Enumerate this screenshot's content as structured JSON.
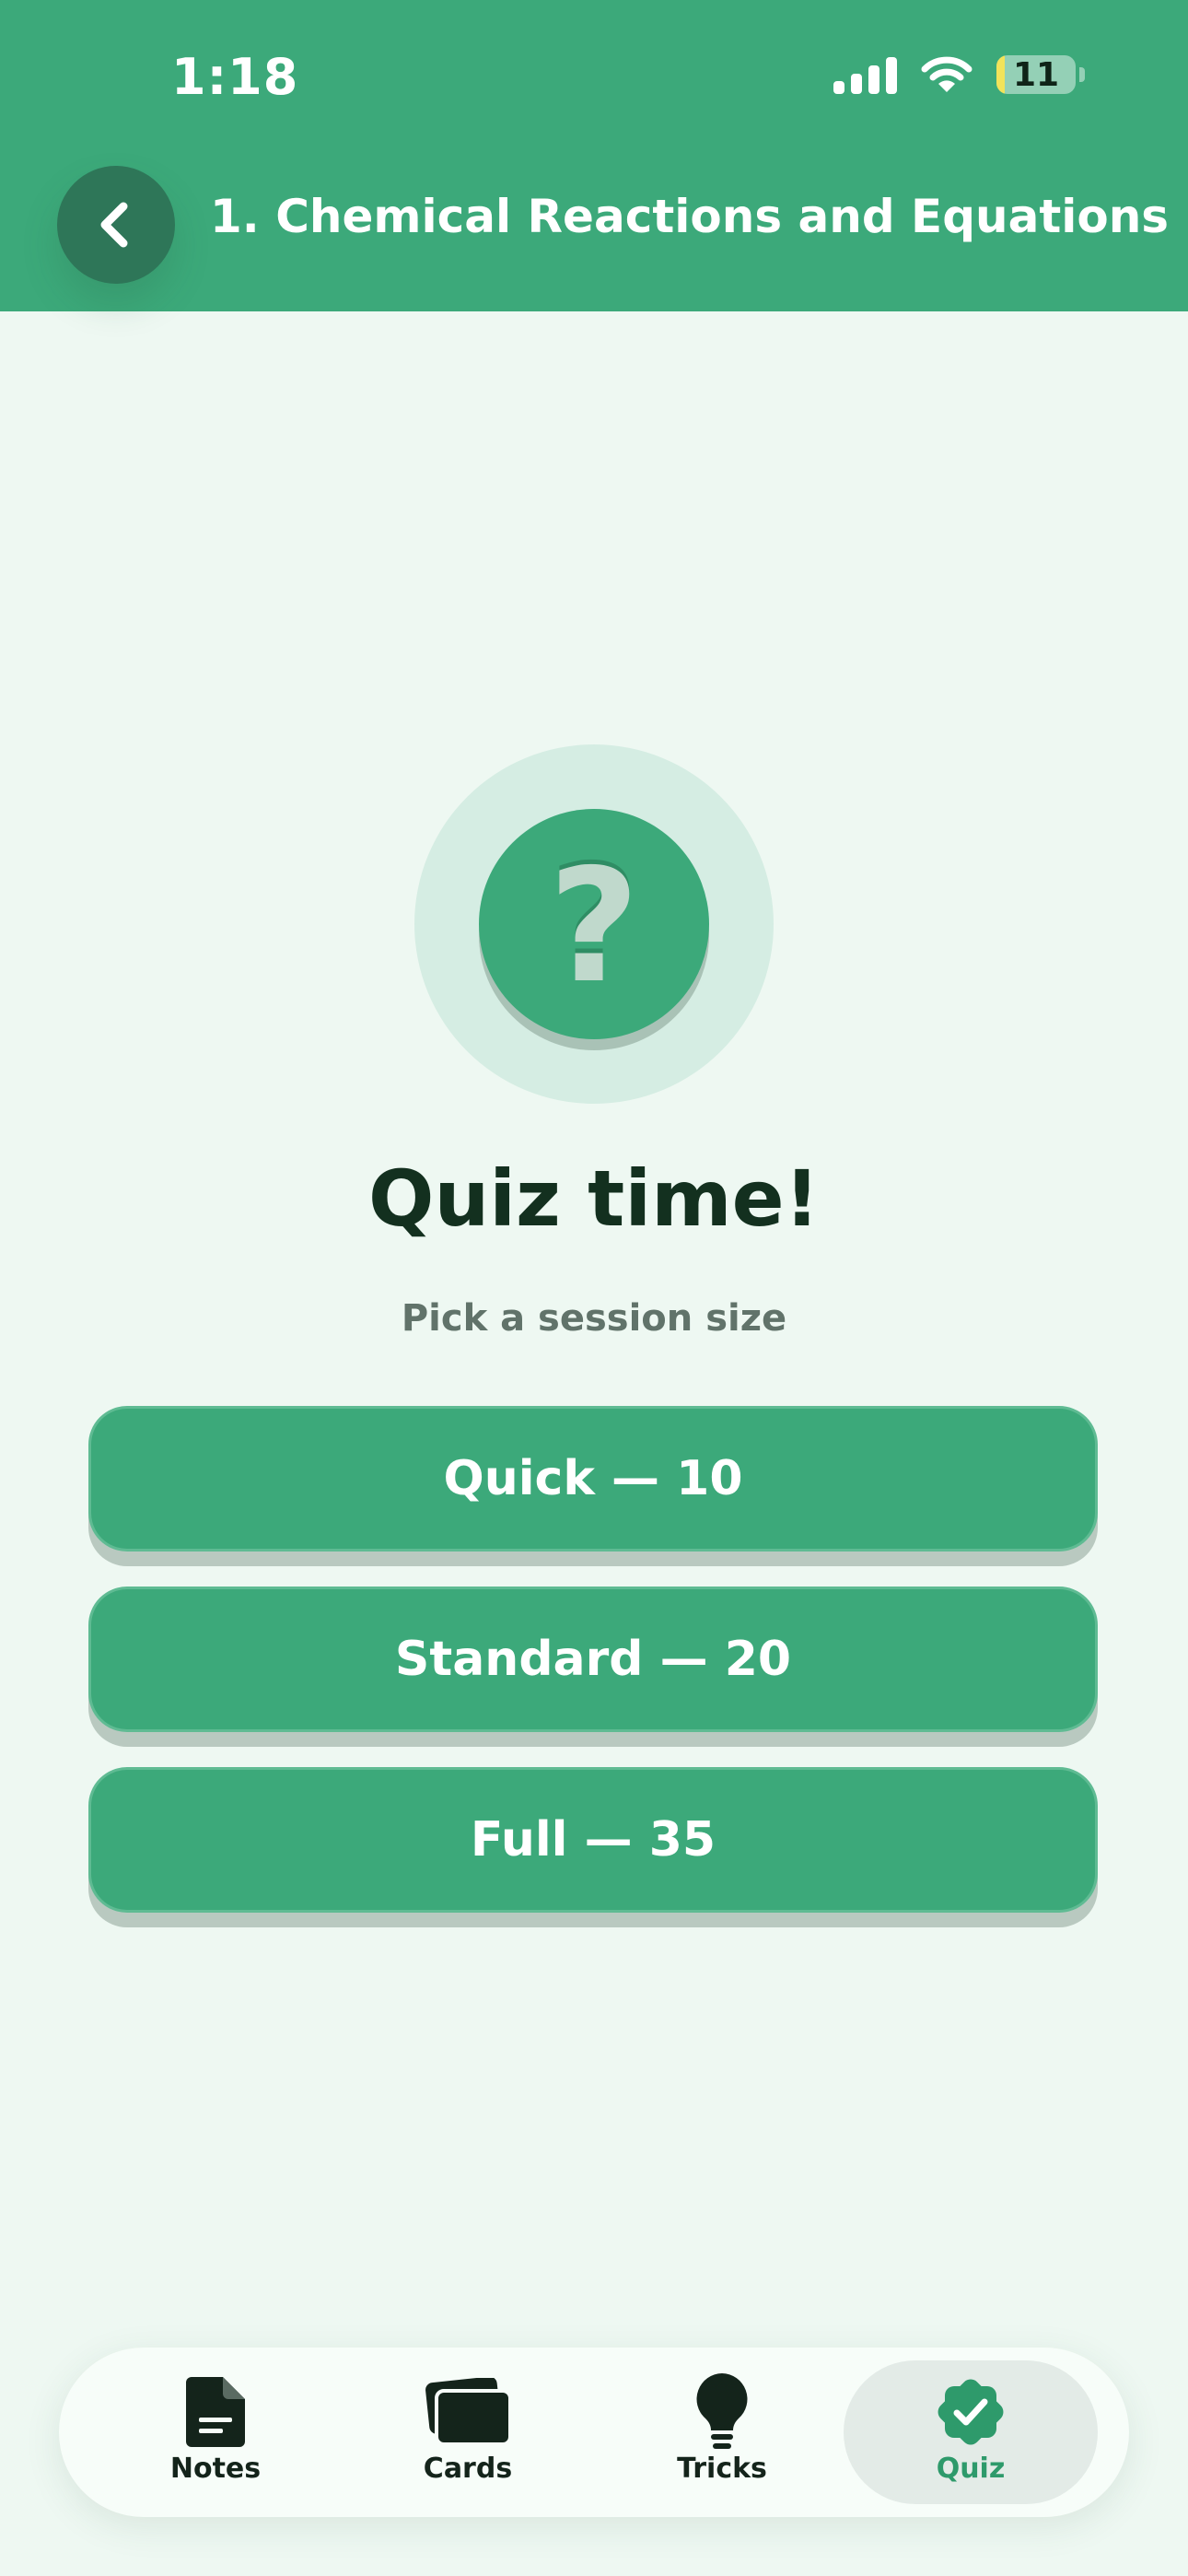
{
  "status_bar": {
    "time": "1:18",
    "battery": "11",
    "battery_level": 0.11
  },
  "header": {
    "title": "1. Chemical Reactions and Equations"
  },
  "hero": {
    "glyph": "?"
  },
  "main": {
    "heading": "Quiz time!",
    "subtitle": "Pick a session size",
    "options": [
      {
        "label": "Quick — 10"
      },
      {
        "label": "Standard — 20"
      },
      {
        "label": "Full — 35"
      }
    ]
  },
  "tabs": [
    {
      "label": "Notes",
      "icon": "document-icon",
      "active": false
    },
    {
      "label": "Cards",
      "icon": "cards-icon",
      "active": false
    },
    {
      "label": "Tricks",
      "icon": "lightbulb-icon",
      "active": false
    },
    {
      "label": "Quiz",
      "icon": "check-badge-icon",
      "active": true
    }
  ],
  "colors": {
    "accent": "#3ca97a",
    "background": "#eef8f2",
    "heading": "#13301f"
  }
}
